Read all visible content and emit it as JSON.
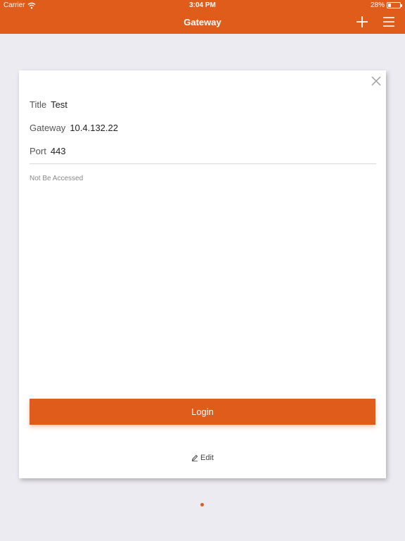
{
  "status_bar": {
    "carrier": "Carrier",
    "time": "3:04 PM",
    "battery_percent": "28%",
    "battery_level": 0.28
  },
  "nav": {
    "title": "Gateway",
    "add_icon": "plus-icon",
    "menu_icon": "menu-icon"
  },
  "card": {
    "fields": [
      {
        "label": "Title",
        "value": "Test"
      },
      {
        "label": "Gateway",
        "value": "10.4.132.22"
      },
      {
        "label": "Port",
        "value": "443"
      }
    ],
    "status": "Not Be Accessed",
    "login_label": "Login",
    "edit_label": "Edit"
  },
  "colors": {
    "accent": "#e05c1a",
    "background": "#ecebf1"
  }
}
